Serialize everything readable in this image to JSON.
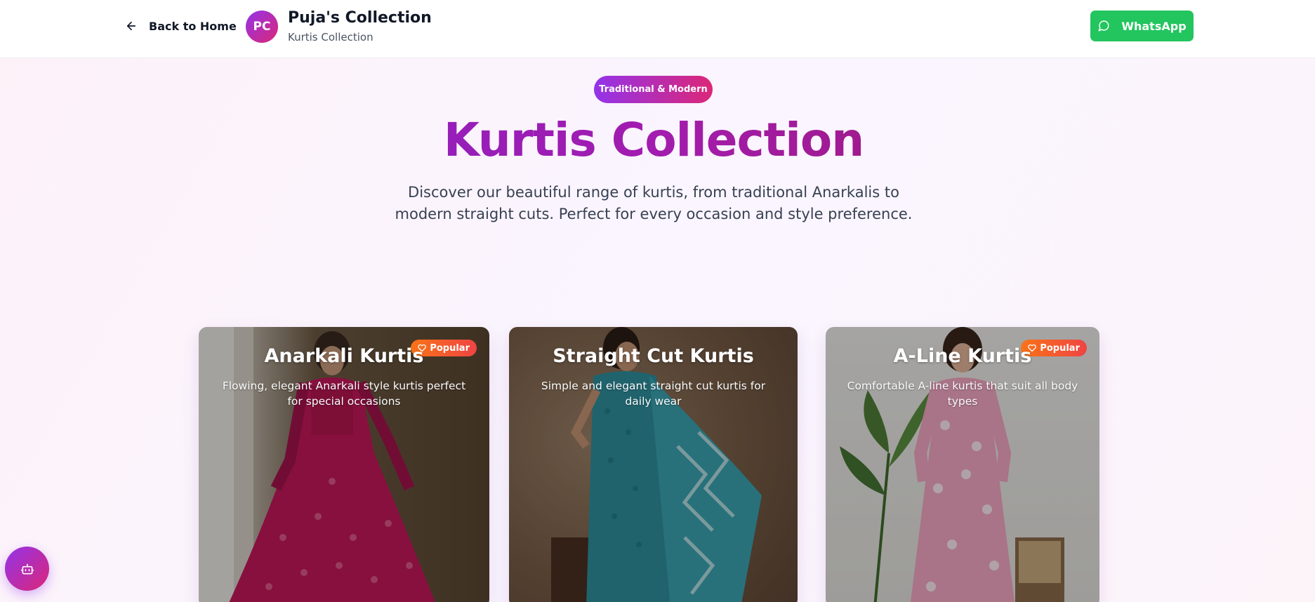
{
  "header": {
    "back_label": "Back to Home",
    "logo_initials": "PC",
    "brand_name": "Puja's Collection",
    "brand_subtitle": "Kurtis Collection",
    "whatsapp_label": "WhatsApp"
  },
  "hero": {
    "badge": "Traditional & Modern",
    "title": "Kurtis Collection",
    "description": "Discover our beautiful range of kurtis, from traditional Anarkalis to modern straight cuts. Perfect for every occasion and style preference."
  },
  "cards": [
    {
      "title": "Anarkali Kurtis",
      "description": "Flowing, elegant Anarkali style kurtis perfect for special occasions",
      "badge": "Popular"
    },
    {
      "title": "Straight Cut Kurtis",
      "description": "Simple and elegant straight cut kurtis for daily wear"
    },
    {
      "title": "A-Line Kurtis",
      "description": "Comfortable A-line kurtis that suit all body types",
      "badge": "Popular"
    }
  ],
  "colors": {
    "accent_purple": "#9333ea",
    "accent_pink": "#db2777",
    "whatsapp_green": "#22c55e",
    "popular_orange": "#f97316"
  },
  "icons": {
    "back": "arrow-left-icon",
    "whatsapp": "message-circle-icon",
    "popular": "heart-icon",
    "chat": "bot-icon"
  }
}
